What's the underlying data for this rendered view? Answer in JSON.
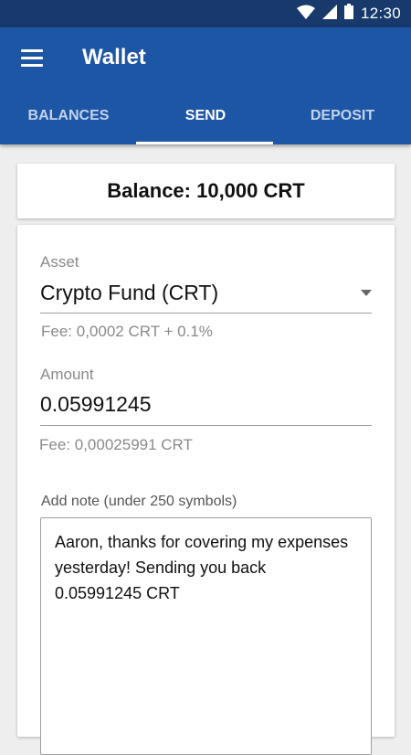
{
  "status_bar": {
    "time": "12:30",
    "icons": [
      "wifi-icon",
      "signal-icon",
      "battery-icon"
    ]
  },
  "app_bar": {
    "title": "Wallet",
    "menu_icon": "menu-icon",
    "color": "#1e56a6"
  },
  "tabs": [
    {
      "label": "BALANCES",
      "active": false
    },
    {
      "label": "SEND",
      "active": true
    },
    {
      "label": "DEPOSIT",
      "active": false
    }
  ],
  "balance": {
    "text": "Balance: 10,000 CRT"
  },
  "form": {
    "asset": {
      "label": "Asset",
      "value": "Crypto Fund (CRT)",
      "fee": "Fee: 0,0002 CRT + 0.1%"
    },
    "amount": {
      "label": "Amount",
      "value": "0.05991245",
      "fee": "Fee: 0,00025991 CRT"
    },
    "note": {
      "label": "Add note (under 250 symbols)",
      "value": "Aaron, thanks for covering my expenses yesterday! Sending you back 0.05991245 CRT"
    }
  }
}
